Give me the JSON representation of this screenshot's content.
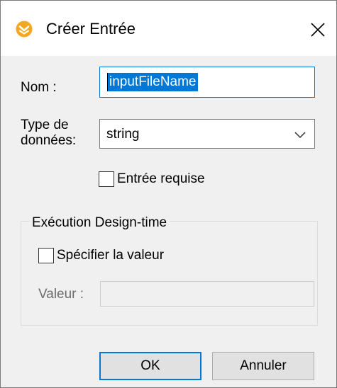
{
  "dialog": {
    "title": "Créer Entrée",
    "app_icon": "mapforce-logo-icon",
    "close_icon": "close-icon"
  },
  "form": {
    "name_label": "Nom :",
    "name_value": "inputFileName",
    "type_label_line1": "Type de",
    "type_label_line2": "données:",
    "type_value": "string",
    "required_label": "Entrée requise",
    "required_checked": false
  },
  "design_time": {
    "legend": "Exécution Design-time",
    "specify_label": "Spécifier la valeur",
    "specify_checked": false,
    "value_label": "Valeur :",
    "value": ""
  },
  "buttons": {
    "ok": "OK",
    "cancel": "Annuler"
  },
  "colors": {
    "accent": "#0078d7",
    "logo": "#f5a623"
  }
}
